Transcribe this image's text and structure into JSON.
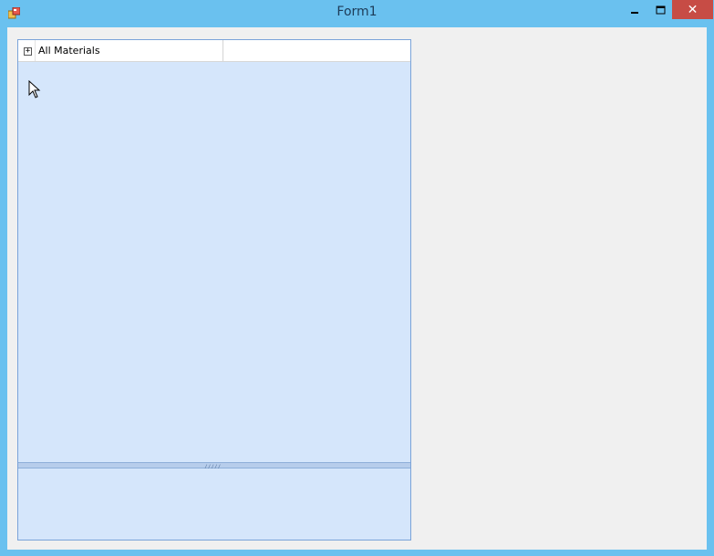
{
  "window": {
    "title": "Form1",
    "controls": {
      "minimize_icon": "minimize-icon",
      "maximize_icon": "maximize-icon",
      "close_icon": "close-icon",
      "close_glyph": "✕"
    },
    "colors": {
      "titlebar": "#6ac1ef",
      "close_button": "#c74c45",
      "client_background": "#f0f0f0"
    }
  },
  "tree": {
    "root_node": {
      "label": "All Materials",
      "expander": "+",
      "expanded": false
    },
    "colors": {
      "background": "#d5e6fb",
      "border": "#7aa3d9"
    }
  },
  "splitter": {
    "grip": "/////"
  }
}
